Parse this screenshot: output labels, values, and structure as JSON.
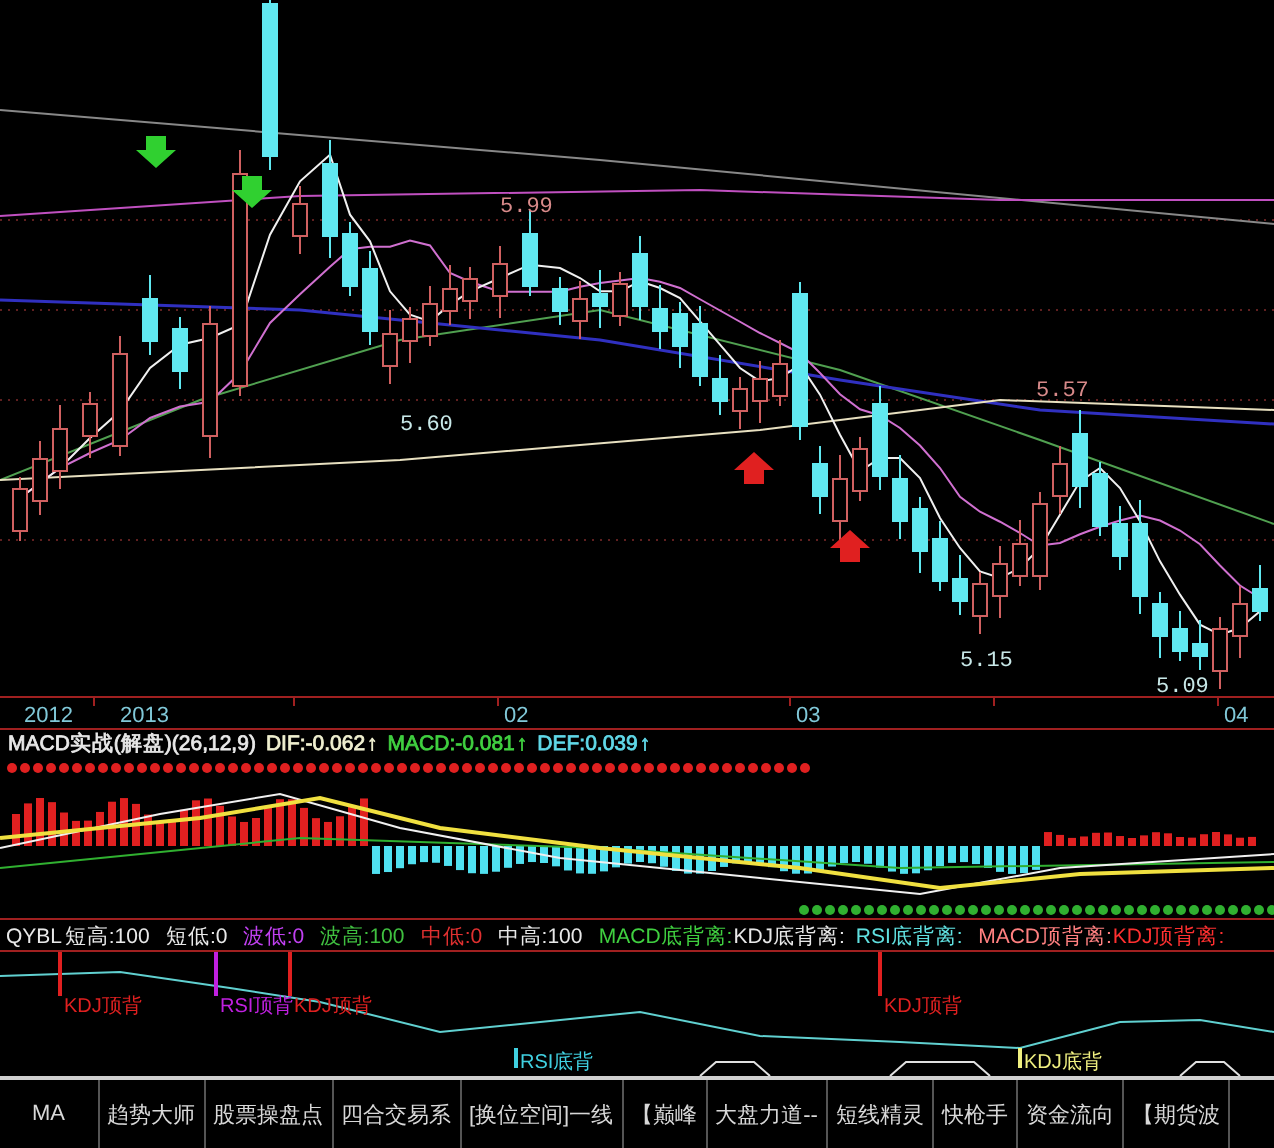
{
  "price_chart": {
    "price_labels": [
      {
        "text": "5.99",
        "color": "#d88a8a"
      },
      {
        "text": "5.60",
        "color": "#c8e8e8"
      },
      {
        "text": "5.57",
        "color": "#d88a8a"
      },
      {
        "text": "5.15",
        "color": "#c8e8e8"
      },
      {
        "text": "5.09",
        "color": "#c8e8e8"
      }
    ]
  },
  "time_axis": {
    "labels": [
      "2012",
      "2013",
      "02",
      "03",
      "04"
    ]
  },
  "macd": {
    "title": "MACD实战(解盘)(26,12,9)",
    "readings": [
      {
        "text": "DIF:-0.062",
        "arrow": "↑",
        "color": "#f0f0d0"
      },
      {
        "text": "MACD:-0.081",
        "arrow": "↑",
        "color": "#40d040"
      },
      {
        "text": "DEF:0.039",
        "arrow": "↑",
        "color": "#60d8e8"
      }
    ]
  },
  "qybl_legend": {
    "items": [
      {
        "text": "QYBL",
        "color": "#e8e8e8"
      },
      {
        "text": "短高:100",
        "color": "#e8e8e8"
      },
      {
        "text": "短低:0",
        "color": "#e8e8e8"
      },
      {
        "text": "波低:0",
        "color": "#c040f0"
      },
      {
        "text": "波高:100",
        "color": "#40c040"
      },
      {
        "text": "中低:0",
        "color": "#e03030"
      },
      {
        "text": "中高:100",
        "color": "#e8e8e8"
      },
      {
        "text": "MACD底背离:",
        "color": "#40d040"
      },
      {
        "text": "KDJ底背离:",
        "color": "#e8e8e8"
      },
      {
        "text": "RSI底背离:",
        "color": "#60e0e0"
      },
      {
        "text": "MACD顶背离:",
        "color": "#ff8080"
      },
      {
        "text": "KDJ顶背离:",
        "color": "#ff3030"
      }
    ]
  },
  "signal_panel": {
    "markers": [
      {
        "text": "KDJ顶背",
        "color": "#e02020"
      },
      {
        "text": "RSI顶背",
        "color": "#c020e0"
      },
      {
        "text": "KDJ顶背",
        "color": "#e02020"
      },
      {
        "text": "RSI底背",
        "color": "#40d0e0"
      },
      {
        "text": "KDJ顶背",
        "color": "#e02020"
      },
      {
        "text": "KDJ底背",
        "color": "#f0f080"
      }
    ]
  },
  "tab_bar": {
    "tabs": [
      "MA",
      "趋势大师",
      "股票操盘点",
      "四合交易系",
      "[换位空间]一线",
      "【巅峰",
      "大盘力道--",
      "短线精灵",
      "快枪手",
      "资金流向",
      "【期货波"
    ]
  }
}
